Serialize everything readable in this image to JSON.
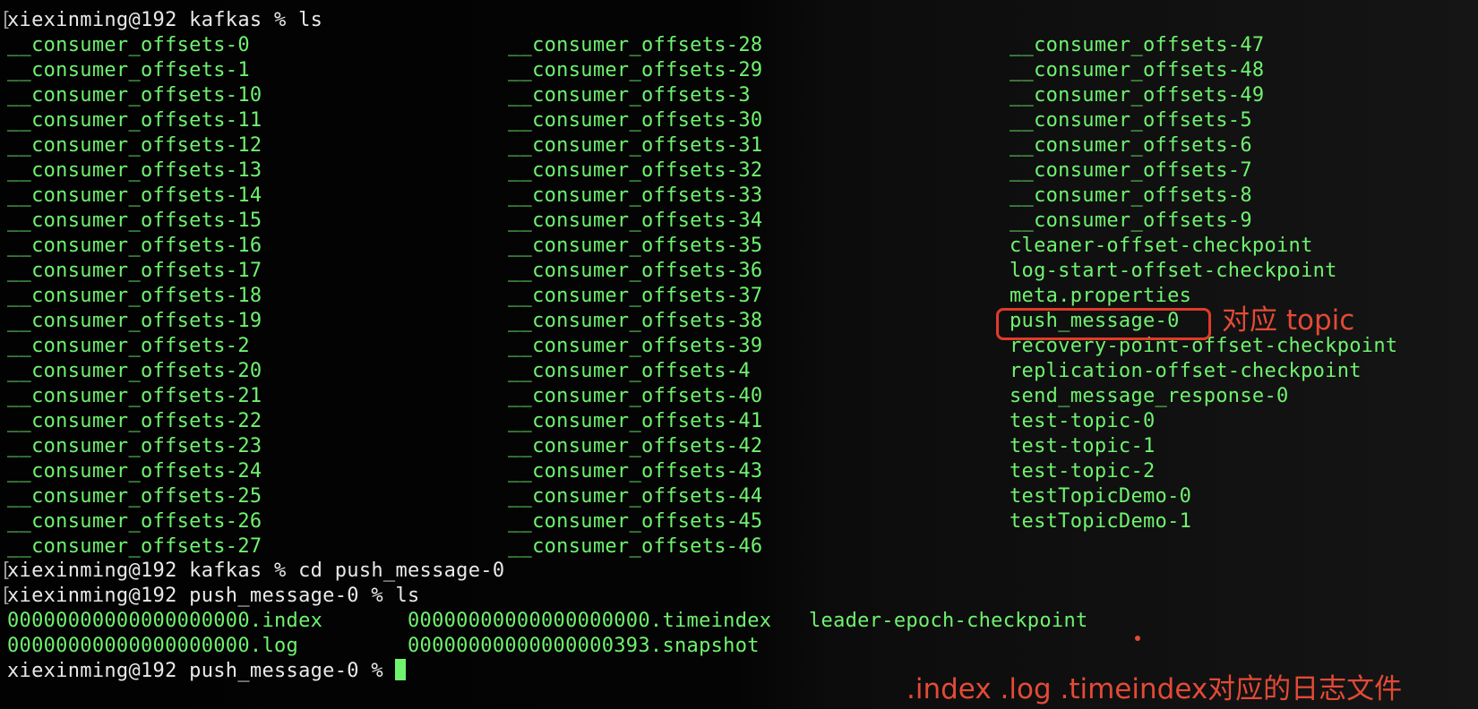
{
  "terminal": {
    "commands": [
      {
        "prompt": "xiexinming@192 kafkas % ",
        "cmd": "ls"
      },
      {
        "prompt": "xiexinming@192 kafkas % ",
        "cmd": "cd push_message-0"
      },
      {
        "prompt": "xiexinming@192 push_message-0 % ",
        "cmd": "ls"
      },
      {
        "prompt": "xiexinming@192 push_message-0 % ",
        "cmd": ""
      }
    ],
    "col1": [
      "__consumer_offsets-0",
      "__consumer_offsets-1",
      "__consumer_offsets-10",
      "__consumer_offsets-11",
      "__consumer_offsets-12",
      "__consumer_offsets-13",
      "__consumer_offsets-14",
      "__consumer_offsets-15",
      "__consumer_offsets-16",
      "__consumer_offsets-17",
      "__consumer_offsets-18",
      "__consumer_offsets-19",
      "__consumer_offsets-2",
      "__consumer_offsets-20",
      "__consumer_offsets-21",
      "__consumer_offsets-22",
      "__consumer_offsets-23",
      "__consumer_offsets-24",
      "__consumer_offsets-25",
      "__consumer_offsets-26",
      "__consumer_offsets-27"
    ],
    "col2": [
      "__consumer_offsets-28",
      "__consumer_offsets-29",
      "__consumer_offsets-3",
      "__consumer_offsets-30",
      "__consumer_offsets-31",
      "__consumer_offsets-32",
      "__consumer_offsets-33",
      "__consumer_offsets-34",
      "__consumer_offsets-35",
      "__consumer_offsets-36",
      "__consumer_offsets-37",
      "__consumer_offsets-38",
      "__consumer_offsets-39",
      "__consumer_offsets-4",
      "__consumer_offsets-40",
      "__consumer_offsets-41",
      "__consumer_offsets-42",
      "__consumer_offsets-43",
      "__consumer_offsets-44",
      "__consumer_offsets-45",
      "__consumer_offsets-46"
    ],
    "col3": [
      "__consumer_offsets-47",
      "__consumer_offsets-48",
      "__consumer_offsets-49",
      "__consumer_offsets-5",
      "__consumer_offsets-6",
      "__consumer_offsets-7",
      "__consumer_offsets-8",
      "__consumer_offsets-9",
      "cleaner-offset-checkpoint",
      "log-start-offset-checkpoint",
      "meta.properties",
      "push_message-0",
      "recovery-point-offset-checkpoint",
      "replication-offset-checkpoint",
      "send_message_response-0",
      "test-topic-0",
      "test-topic-1",
      "test-topic-2",
      "testTopicDemo-0",
      "testTopicDemo-1"
    ],
    "files_col1": [
      "00000000000000000000.index",
      "00000000000000000000.log"
    ],
    "files_col2": [
      "00000000000000000000.timeindex",
      "00000000000000000393.snapshot"
    ],
    "files_col3": [
      "leader-epoch-checkpoint"
    ]
  },
  "annotations": {
    "topic_label": "对应 topic",
    "files_label": ".index .log .timeindex对应的日志文件"
  },
  "colors": {
    "text_green": "#6ff26f",
    "annotation_red": "#e34a36"
  }
}
